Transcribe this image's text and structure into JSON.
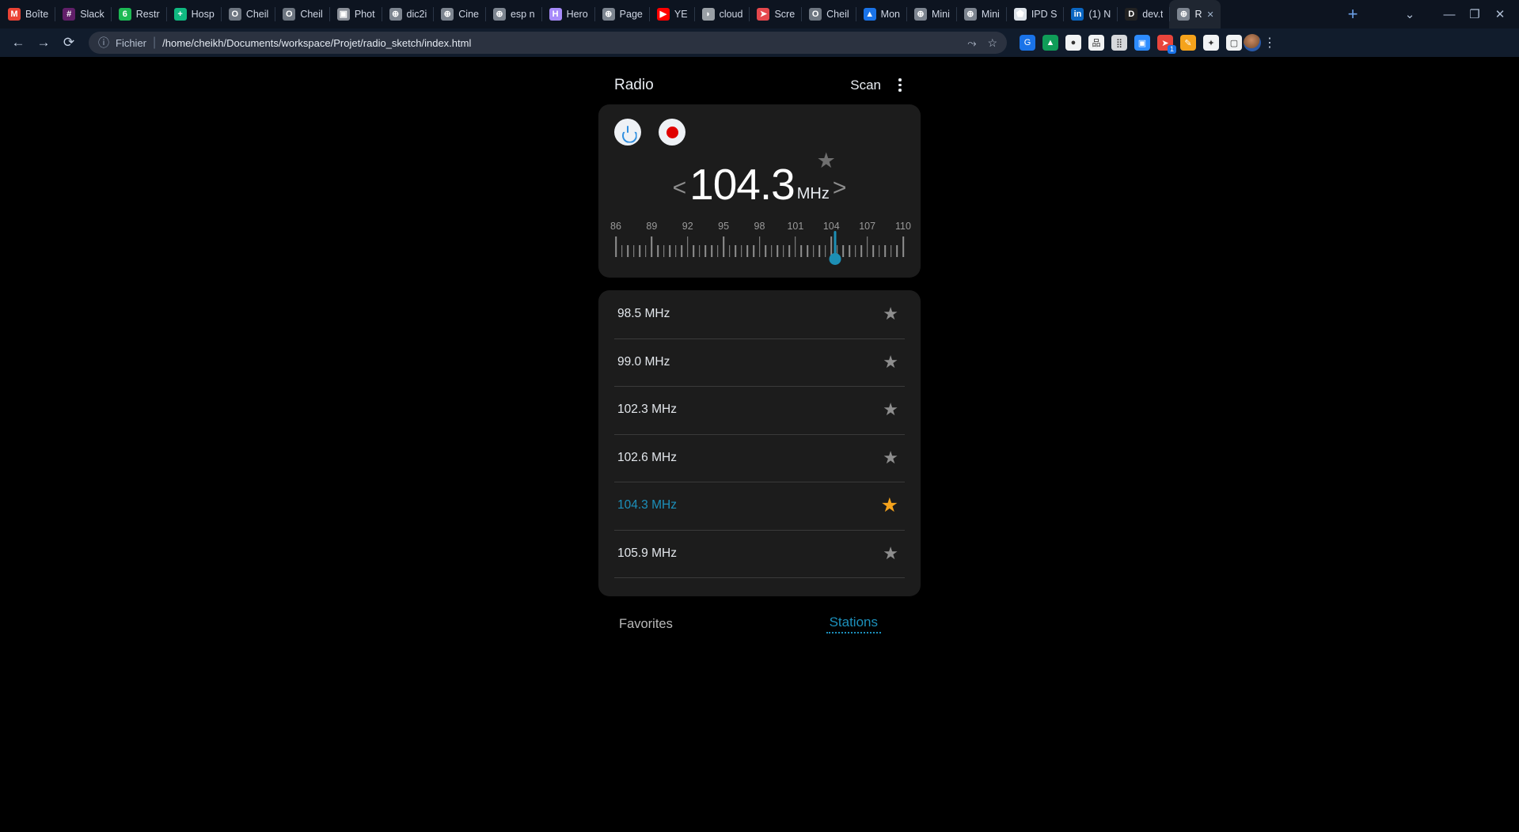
{
  "browser": {
    "tabs": [
      {
        "label": "Boîte",
        "icon": "gmail-icon",
        "color": "#ea4335",
        "glyph": "M"
      },
      {
        "label": "Slack",
        "icon": "slack-icon",
        "color": "#611f69",
        "glyph": "#"
      },
      {
        "label": "Restr",
        "icon": "leaf-icon",
        "color": "#1db954",
        "glyph": "6"
      },
      {
        "label": "Hosp",
        "icon": "cross-icon",
        "color": "#10b981",
        "glyph": "+"
      },
      {
        "label": "Cheil",
        "icon": "github-icon",
        "color": "#6e7681",
        "glyph": "O"
      },
      {
        "label": "Cheil",
        "icon": "github-icon",
        "color": "#6e7681",
        "glyph": "O"
      },
      {
        "label": "Phot",
        "icon": "photo-icon",
        "color": "#8a8f98",
        "glyph": "▣"
      },
      {
        "label": "dic2i",
        "icon": "globe-icon",
        "color": "#7d8590",
        "glyph": "⊕"
      },
      {
        "label": "Cine",
        "icon": "globe-icon",
        "color": "#7d8590",
        "glyph": "⊕"
      },
      {
        "label": "esp n",
        "icon": "globe-icon",
        "color": "#7d8590",
        "glyph": "⊕"
      },
      {
        "label": "Hero",
        "icon": "heroku-icon",
        "color": "#a78bfa",
        "glyph": "H"
      },
      {
        "label": "Page",
        "icon": "globe-icon",
        "color": "#7d8590",
        "glyph": "⊕"
      },
      {
        "label": "YE",
        "icon": "youtube-icon",
        "color": "#ff0000",
        "glyph": "▶"
      },
      {
        "label": "cloud",
        "icon": "cloudinary-icon",
        "color": "#9aa0a6",
        "glyph": "◗"
      },
      {
        "label": "Scre",
        "icon": "screencast-icon",
        "color": "#e5484d",
        "glyph": "➤"
      },
      {
        "label": "Cheil",
        "icon": "github-icon",
        "color": "#6e7681",
        "glyph": "O"
      },
      {
        "label": "Mon",
        "icon": "google-drive-icon",
        "color": "#1a73e8",
        "glyph": "▲"
      },
      {
        "label": "Mini",
        "icon": "globe-icon",
        "color": "#7d8590",
        "glyph": "⊕"
      },
      {
        "label": "Mini",
        "icon": "globe-icon",
        "color": "#7d8590",
        "glyph": "⊕"
      },
      {
        "label": "IPD S",
        "icon": "school-icon",
        "color": "#dde3ea",
        "glyph": "⬟"
      },
      {
        "label": "(1) N",
        "icon": "linkedin-icon",
        "color": "#0a66c2",
        "glyph": "in"
      },
      {
        "label": "dev.t",
        "icon": "devto-icon",
        "color": "#222222",
        "glyph": "D"
      },
      {
        "label": "R",
        "icon": "globe-icon",
        "color": "#7d8590",
        "glyph": "⊕",
        "active": true
      }
    ],
    "new_tab_glyph": "+",
    "tab_search_glyph": "⌄",
    "window_minimize": "—",
    "window_maximize": "❐",
    "window_close": "✕",
    "nav": {
      "back": "←",
      "forward": "→",
      "reload": "⟳"
    },
    "omnibox": {
      "info_icon": "ⓘ",
      "scheme_label": "Fichier",
      "separator": "|",
      "url": "/home/cheikh/Documents/workspace/Projet/radio_sketch/index.html",
      "share_icon": "⤳",
      "bookmark_icon": "☆"
    },
    "extensions": [
      {
        "name": "google-translate-icon",
        "color": "#1a73e8",
        "glyph": "G"
      },
      {
        "name": "google-drive-icon",
        "color": "#0f9d58",
        "glyph": "▲"
      },
      {
        "name": "pill-icon",
        "color": "#f1f3f4",
        "glyph": "●"
      },
      {
        "name": "sitemap-icon",
        "color": "#f1f3f4",
        "glyph": "品"
      },
      {
        "name": "grid-icon",
        "color": "#d6d8db",
        "glyph": "⣿"
      },
      {
        "name": "zoom-meeting-icon",
        "color": "#2d8cff",
        "glyph": "▣"
      },
      {
        "name": "video-download-icon",
        "color": "#e8453c",
        "glyph": "➤",
        "badge": "1"
      },
      {
        "name": "highlighter-icon",
        "color": "#f5a31c",
        "glyph": "✎"
      },
      {
        "name": "puzzle-extensions-icon",
        "color": "#f1f3f4",
        "glyph": "✦"
      },
      {
        "name": "sidebar-icon",
        "color": "#f1f3f4",
        "glyph": "▢"
      }
    ],
    "profile_avatar": "avatar",
    "menu_icon": "⋮"
  },
  "app": {
    "title": "Radio",
    "scan_label": "Scan",
    "overflow_menu": "kebab-menu",
    "controls": {
      "power": "power-icon",
      "record": "record-icon"
    },
    "frequency": {
      "value": "104.3",
      "unit": "MHz",
      "prev": "<",
      "next": ">",
      "favorite_star": "★",
      "is_favorite": true
    },
    "scale": {
      "min": 86,
      "max": 110,
      "label_step": 3,
      "minor_step": 0.5,
      "labels": [
        86,
        89,
        92,
        95,
        98,
        101,
        104,
        107,
        110
      ],
      "needle_value": 104.3,
      "needle_color": "#1d8fb5"
    },
    "stations": [
      {
        "label": "98.5 MHz",
        "favorite": false,
        "current": false
      },
      {
        "label": "99.0 MHz",
        "favorite": false,
        "current": false
      },
      {
        "label": "102.3 MHz",
        "favorite": false,
        "current": false
      },
      {
        "label": "102.6 MHz",
        "favorite": false,
        "current": false
      },
      {
        "label": "104.3 MHz",
        "favorite": true,
        "current": true
      },
      {
        "label": "105.9 MHz",
        "favorite": false,
        "current": false
      }
    ],
    "star_glyph": "★",
    "bottom": {
      "favorites_label": "Favorites",
      "stations_label": "Stations"
    },
    "colors": {
      "accent": "#1c90bb",
      "favorite": "#f5a31c",
      "card": "#1c1c1c",
      "background": "#000000",
      "text": "#e3e7ec"
    }
  }
}
